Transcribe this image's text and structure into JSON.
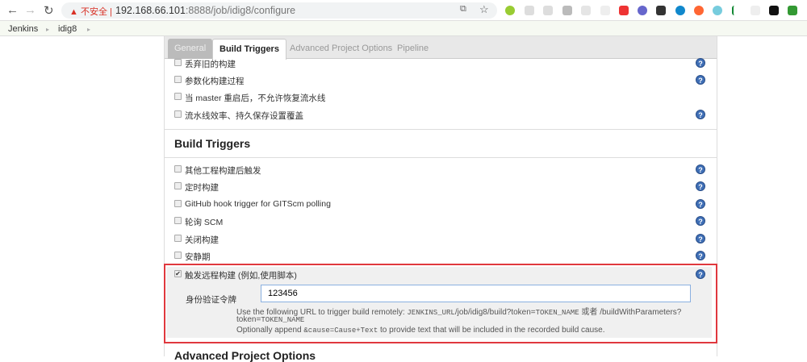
{
  "browser": {
    "security_label": "不安全",
    "url_host": "192.168.66.101",
    "url_path": ":8888/job/idig8/configure"
  },
  "breadcrumb": [
    "Jenkins",
    "idig8"
  ],
  "tabs": [
    "General",
    "Build Triggers",
    "Advanced Project Options",
    "Pipeline"
  ],
  "general_options": [
    "丢弃旧的构建",
    "参数化构建过程",
    "当 master 重启后，不允许恢复流水线",
    "流水线效率、持久保存设置覆盖"
  ],
  "build_triggers": {
    "heading": "Build Triggers",
    "options": [
      "其他工程构建后触发",
      "定时构建",
      "GitHub hook trigger for GITScm polling",
      "轮询 SCM",
      "关闭构建",
      "安静期"
    ],
    "remote": {
      "label": "触发远程构建 (例如,使用脚本)",
      "checked": true,
      "token_label": "身份验证令牌",
      "token_value": "123456",
      "desc1_a": "Use the following URL to trigger build remotely: ",
      "desc1_code": "JENKINS_URL",
      "desc1_b": "/job/idig8/build?token=",
      "desc1_code2": "TOKEN_NAME",
      "desc1_c": " 或者 /buildWithParameters?",
      "desc2_a": "token=",
      "desc2_code": "TOKEN_NAME",
      "desc3_a": "Optionally append ",
      "desc3_code": "&cause=Cause+Text",
      "desc3_b": " to provide text that will be included in the recorded build cause."
    }
  },
  "advanced_heading": "Advanced Project Options",
  "help_glyph": "?"
}
